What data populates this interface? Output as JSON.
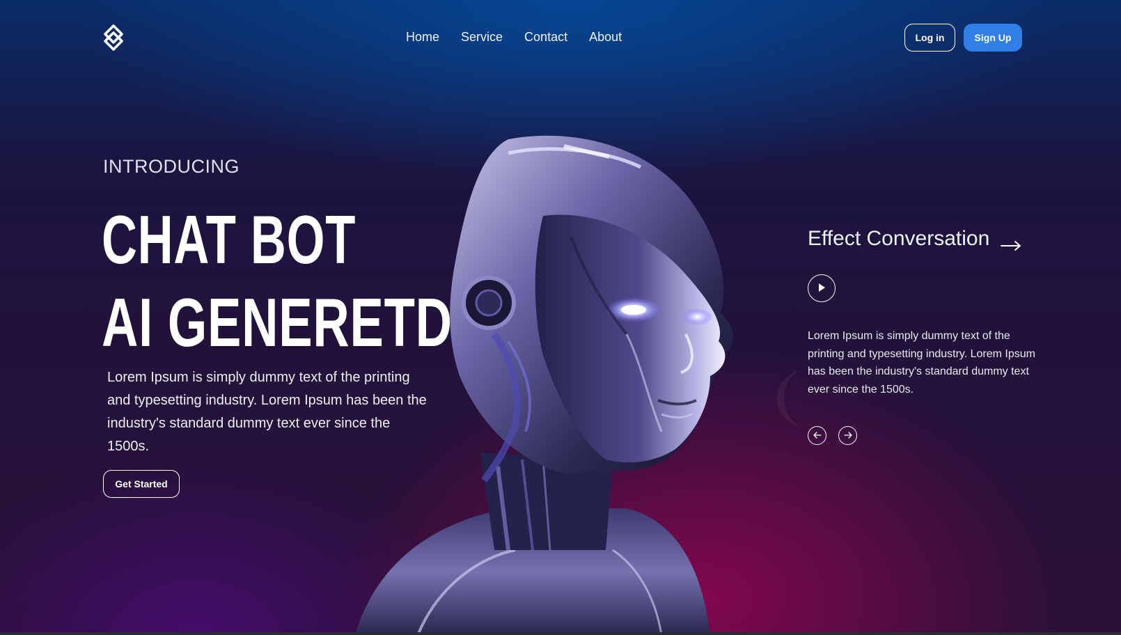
{
  "colors": {
    "accent": "#2f7fe6",
    "background_dark": "#1d1233",
    "glow_blue": "#0a4896",
    "glow_magenta": "#8c0650",
    "text": "#ffffff"
  },
  "nav": {
    "logo_icon": "diamond-link-logo-icon",
    "links": [
      "Home",
      "Service",
      "Contact",
      "About"
    ],
    "login_label": "Log in",
    "signup_label": "Sign Up"
  },
  "hero": {
    "intro": "INTRODUCING",
    "headline_line1": "CHAT BOT",
    "headline_line2": "AI GENERETDE",
    "description": "Lorem Ipsum is simply dummy text of the printing and typesetting industry. Lorem Ipsum has been the industry's standard dummy text ever since the 1500s.",
    "cta_label": "Get Started",
    "image_icon": "robot-head-image"
  },
  "side_panel": {
    "title": "Effect Conversation",
    "title_icon": "arrow-right-icon",
    "play_icon": "play-icon",
    "description": "Lorem Ipsum is simply dummy text of the printing and typesetting industry. Lorem Ipsum has been the industry's standard dummy text ever since the 1500s.",
    "prev_icon": "arrow-left-icon",
    "next_icon": "arrow-right-icon"
  }
}
